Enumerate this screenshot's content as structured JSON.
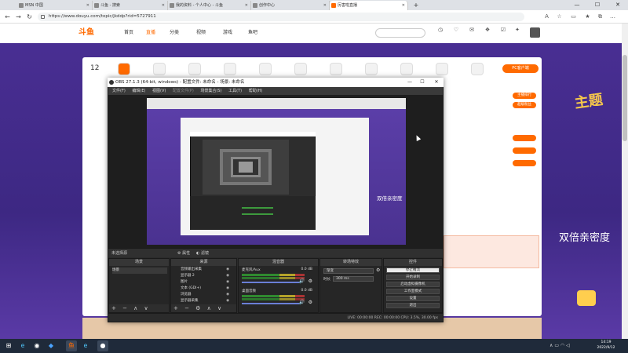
{
  "browser": {
    "tabs": [
      {
        "label": "MSN 中国"
      },
      {
        "label": "斗鱼 - 搜索"
      },
      {
        "label": "我的资料 - 个人中心 - 斗鱼"
      },
      {
        "label": "创作中心"
      },
      {
        "label": "厉害啦直播"
      }
    ],
    "new_tab": "+",
    "url": "https://www.douyu.com/topic/jkddp?rid=5727911",
    "window_controls": {
      "minimize": "—",
      "maximize": "☐",
      "close": "✕"
    }
  },
  "site": {
    "logo": "斗鱼",
    "nav": [
      "首页",
      "直播",
      "分类",
      "视频",
      "游戏",
      "鱼吧"
    ],
    "nav_active_index": 1,
    "search_placeholder": "",
    "header_icons": [
      "",
      "",
      "",
      "",
      "",
      ""
    ],
    "day_number": "12",
    "follow_button": "PC客户端",
    "side_list": [
      {
        "label": "",
        "button": "主播排行"
      },
      {
        "label": "",
        "button": "超级粉丝"
      },
      {
        "label": "",
        "button": ""
      },
      {
        "label": "",
        "button": ""
      },
      {
        "label": "",
        "button": ""
      }
    ],
    "ad_line1": "",
    "ad_line2": "",
    "overlay_text": "双倍亲密度",
    "deco_text": "主题"
  },
  "obs": {
    "title": "OBS 27.1.3 (64-bit, windows) - 配置文件: 未命名 - 场景: 未命名",
    "menu": [
      "文件(F)",
      "编辑(E)",
      "视图(V)",
      "配置文件(P)",
      "场景集合(S)",
      "工具(T)",
      "帮助(H)"
    ],
    "scene_bar": {
      "label": "未选择源",
      "props": "属性",
      "filters": "滤镜"
    },
    "docks": {
      "scenes": {
        "title": "场景",
        "items": [
          "场景"
        ]
      },
      "sources": {
        "title": "来源",
        "items": [
          "音频输出采集",
          "显示器 2",
          "图片",
          "文本 (GDI+)",
          "浏览器",
          "显示器采集"
        ]
      },
      "mixer": {
        "title": "混音器",
        "tracks": [
          {
            "name": "麦克风/Aux",
            "db": "0.0 dB"
          },
          {
            "name": "桌面音频",
            "db": "0.0 dB"
          }
        ]
      },
      "transitions": {
        "title": "转场特效",
        "mode_label": "",
        "mode": "渐变",
        "duration_label": "时长",
        "duration": "300 ms"
      },
      "controls": {
        "title": "控件",
        "buttons": [
          "停止推流",
          "开始录制",
          "启动虚拟摄像机",
          "工作室模式",
          "设置",
          "退出"
        ]
      }
    },
    "status": "LIVE: 00:00:00    REC: 00:00:00    CPU: 3.5%, 30.00 fps",
    "nested_overlay": "双倍亲密度"
  },
  "taskbar": {
    "apps": [
      {
        "icon": "windows-start-icon",
        "glyph": "⊞"
      },
      {
        "icon": "edge-icon",
        "glyph": "e"
      },
      {
        "icon": "steam-icon",
        "glyph": "◉"
      },
      {
        "icon": "app-icon",
        "glyph": "◆"
      },
      {
        "icon": "douyu-icon",
        "glyph": "鱼"
      },
      {
        "icon": "browser-icon",
        "glyph": "e"
      },
      {
        "icon": "obs-icon",
        "glyph": "●"
      }
    ],
    "time": "14:19",
    "date": "2022/9/12"
  },
  "colors": {
    "accent": "#ff6a00",
    "page_purple": "#4a2f94",
    "obs_dark": "#2b2b2b"
  }
}
